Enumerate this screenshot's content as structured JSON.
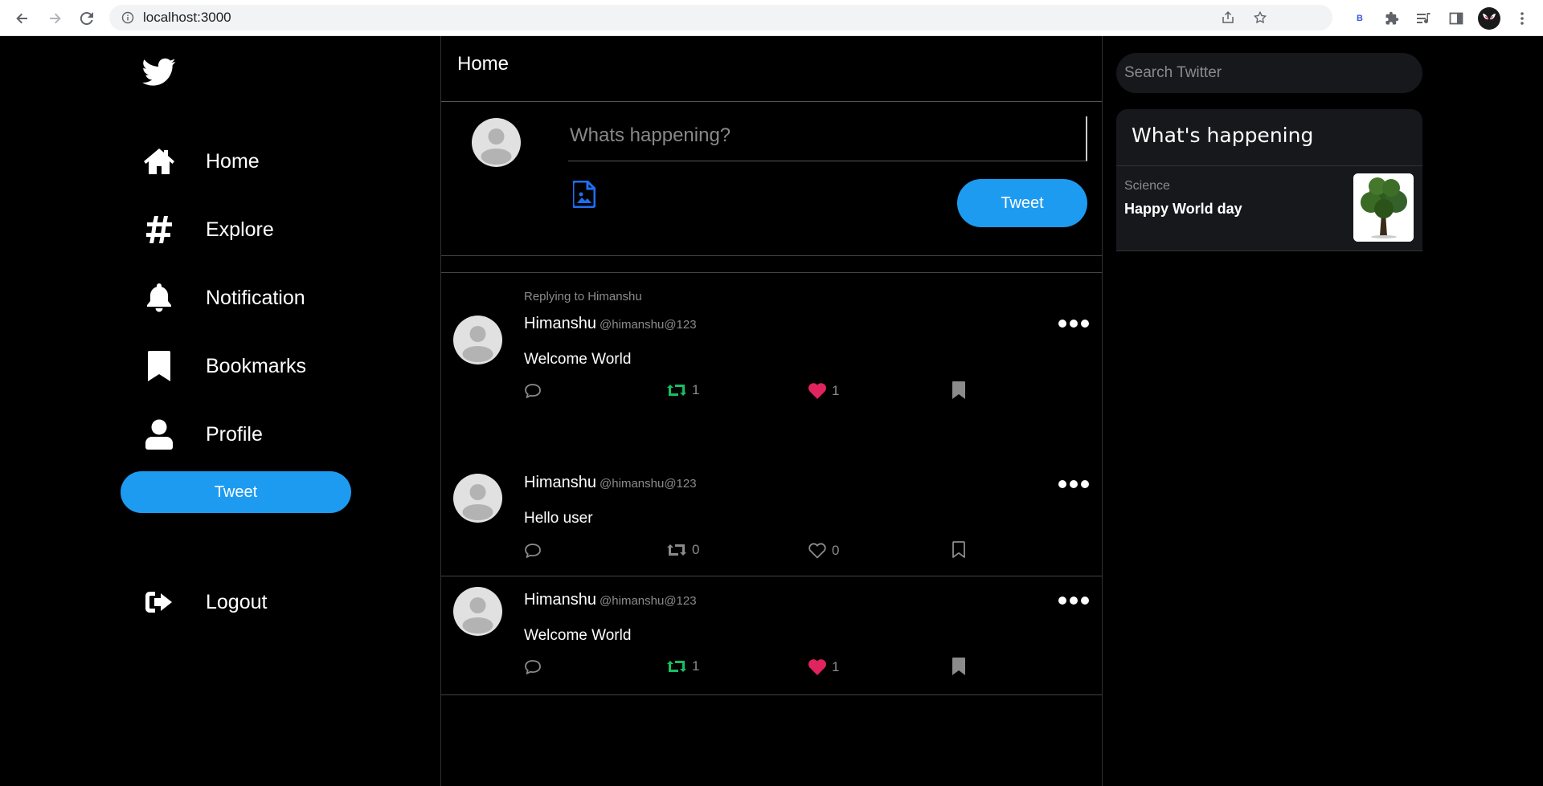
{
  "browser": {
    "url": "localhost:3000",
    "extension_badge": "B"
  },
  "sidebar": {
    "items": [
      {
        "label": "Home",
        "icon": "home-icon"
      },
      {
        "label": "Explore",
        "icon": "hashtag-icon"
      },
      {
        "label": "Notification",
        "icon": "bell-icon"
      },
      {
        "label": "Bookmarks",
        "icon": "bookmark-icon"
      },
      {
        "label": "Profile",
        "icon": "user-icon"
      }
    ],
    "tweet_button": "Tweet",
    "logout": "Logout"
  },
  "feed": {
    "title": "Home",
    "composer": {
      "placeholder": "Whats happening?",
      "button": "Tweet"
    },
    "tweets": [
      {
        "reply_to": "Replying to Himanshu",
        "name": "Himanshu",
        "handle": "@himanshu@123",
        "text": "Welcome World",
        "retweets": "1",
        "likes": "1",
        "retweeted": true,
        "liked": true,
        "bookmarked": true
      },
      {
        "reply_to": "",
        "name": "Himanshu",
        "handle": "@himanshu@123",
        "text": "Hello user",
        "retweets": "0",
        "likes": "0",
        "retweeted": false,
        "liked": false,
        "bookmarked": false
      },
      {
        "reply_to": "",
        "name": "Himanshu",
        "handle": "@himanshu@123",
        "text": "Welcome World",
        "retweets": "1",
        "likes": "1",
        "retweeted": true,
        "liked": true,
        "bookmarked": true
      }
    ]
  },
  "right": {
    "search_placeholder": "Search Twitter",
    "trends_title": "What's happening",
    "trend": {
      "category": "Science",
      "topic": "Happy World day"
    }
  },
  "colors": {
    "accent": "#1d9bf0",
    "retweet": "#17bf63",
    "like": "#f91880",
    "muted": "#8b8b8b"
  }
}
